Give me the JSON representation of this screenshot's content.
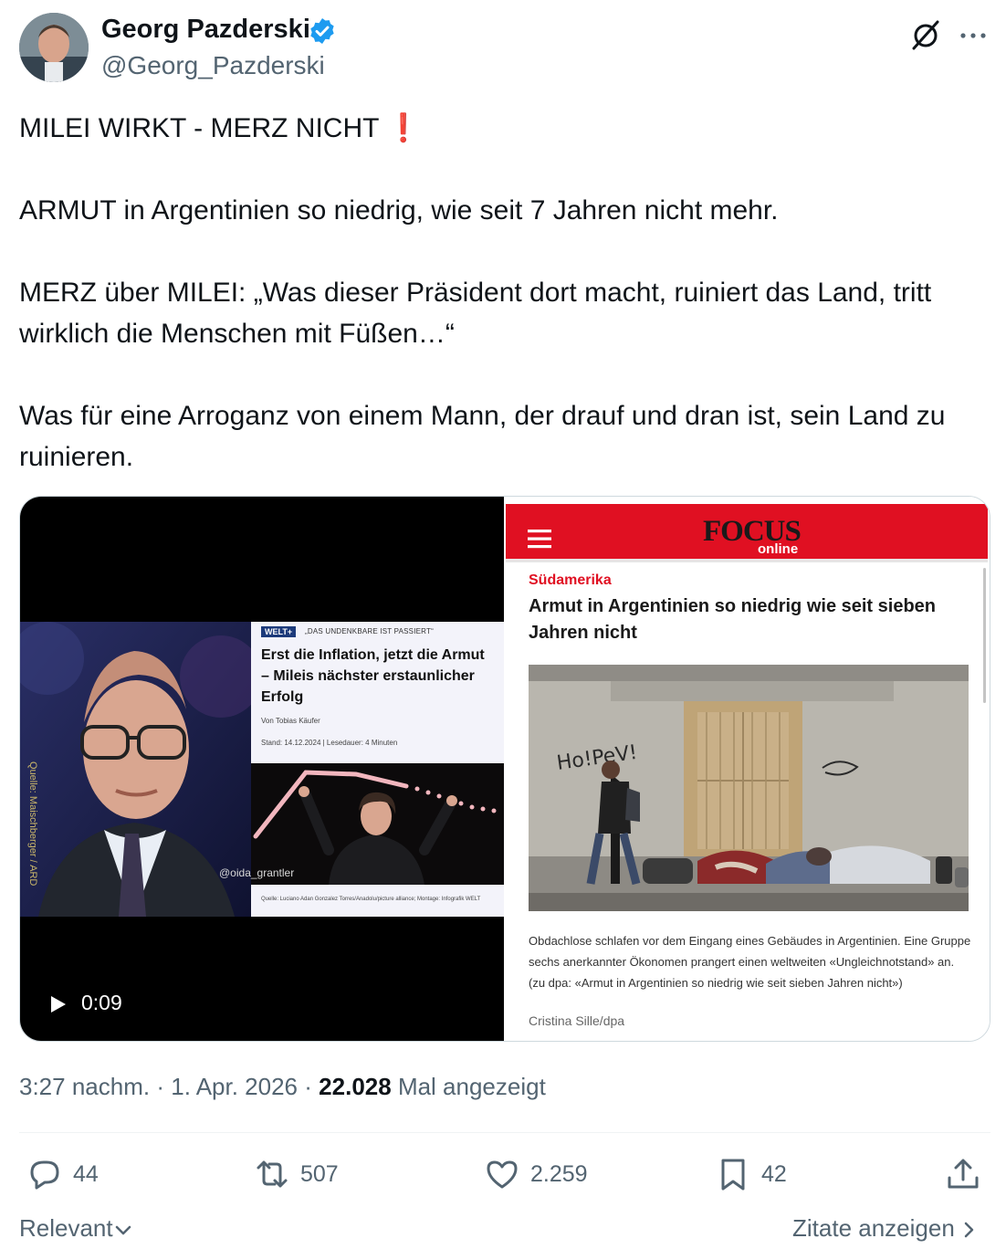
{
  "author": {
    "name": "Georg Pazderski",
    "handle": "@Georg_Pazderski",
    "verified": true,
    "verified_color": "#1d9bf0"
  },
  "tweet": {
    "line1": "MILEI WIRKT - MERZ NICHT",
    "line1_emoji": "❗",
    "line2": "ARMUT in Argentinien so niedrig, wie seit 7 Jahren nicht mehr.",
    "line3": "MERZ über MILEI: „Was dieser Präsident dort macht, ruiniert das Land, tritt wirklich die Menschen mit Füßen…“",
    "line4": "Was für eine Arroganz von einem Mann, der drauf und dran ist, sein Land zu ruinieren."
  },
  "video": {
    "duration": "0:09",
    "source_label": "Quelle: Maischberger / ARD",
    "watermark": "@oida_grantler",
    "welt": {
      "logo": "WELT+",
      "kicker": "„DAS UNDENKBARE IST PASSIERT“",
      "headline": "Erst die Inflation, jetzt die Armut – Mileis nächster erstaunlicher Erfolg",
      "author": "Von Tobias Käufer",
      "meta": "Stand: 14.12.2024  |  Lesedauer: 4 Minuten",
      "credit": "Quelle: Luciano Adan Gonzalez Torres/Anadolu/picture alliance; Montage: Infografik WELT"
    }
  },
  "focus_article": {
    "logo": "FOCUS",
    "logo_sub": "online",
    "brand_color": "#e01022",
    "category": "Südamerika",
    "headline": "Armut in Argentinien so niedrig wie seit sieben Jahren nicht",
    "photo_graffiti": "Ho!PeV!",
    "caption": "Obdachlose schlafen vor dem Eingang eines Gebäudes in Argentinien. Eine Gruppe sechs anerkannter Ökonomen prangert einen weltweiten «Ungleichnotstand» an. (zu dpa: «Armut in Argentinien so niedrig wie seit sieben Jahren nicht»)",
    "photo_credit": "Cristina Sille/dpa"
  },
  "meta": {
    "time": "3:27 nachm.",
    "date": "1. Apr. 2026",
    "separator": "·",
    "views": "22.028",
    "views_label": "Mal angezeigt"
  },
  "actions": {
    "replies": "44",
    "reposts": "507",
    "likes": "2.259",
    "bookmarks": "42"
  },
  "footer": {
    "sort_label": "Relevant",
    "quotes_label": "Zitate anzeigen"
  },
  "icons": {
    "grok": "grok-icon",
    "more": "more-icon",
    "reply": "reply-icon",
    "repost": "repost-icon",
    "like": "heart-icon",
    "bookmark": "bookmark-icon",
    "share": "share-icon",
    "play": "play-icon",
    "menu": "hamburger-menu-icon"
  }
}
